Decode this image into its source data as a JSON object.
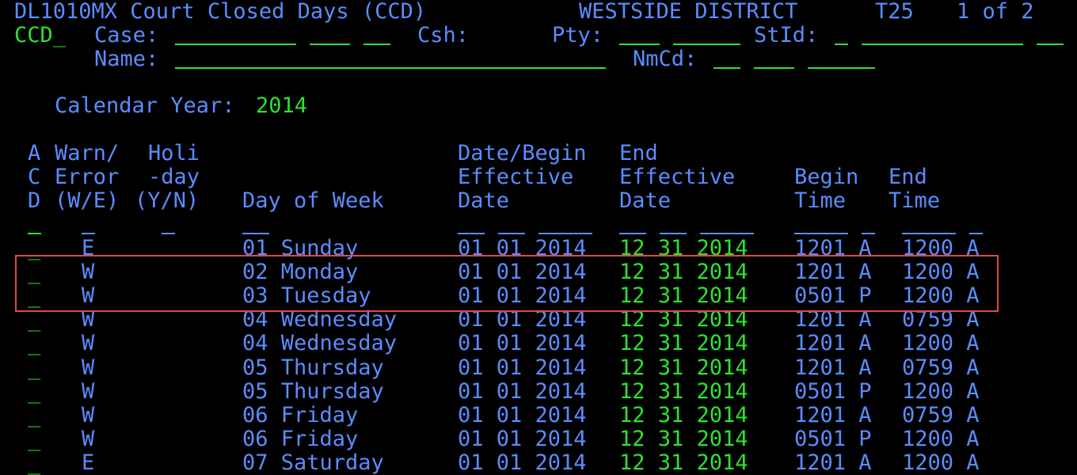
{
  "header": {
    "screen_id": "DL1010MX Court Closed Days (CCD)",
    "district": "WESTSIDE DISTRICT",
    "terminal": "T25",
    "page": "1 of 2"
  },
  "command": {
    "value": "CCD_"
  },
  "fields": {
    "case_label": "Case:",
    "csh_label": "Csh:",
    "pty_label": "Pty:",
    "stid_label": "StId:",
    "name_label": "Name:",
    "nmcd_label": "NmCd:"
  },
  "calendar": {
    "label": "Calendar Year:",
    "year": "2014"
  },
  "columns": {
    "acd": [
      "A",
      "C",
      "D"
    ],
    "warn": [
      "Warn/",
      "Error",
      "(W/E)"
    ],
    "holiday": [
      "Holi",
      "-day",
      "(Y/N)"
    ],
    "day_of_week": "Day of Week",
    "begin_date": [
      "Date/Begin",
      "Effective",
      "Date"
    ],
    "end_date": [
      "End",
      "Effective",
      "Date"
    ],
    "begin_time": [
      "Begin",
      "Time"
    ],
    "end_time": [
      "End",
      "Time"
    ]
  },
  "rows": [
    {
      "acd": "_",
      "we": "E",
      "holiday": "",
      "day": "01 Sunday",
      "begin": "01 01 2014",
      "end": "12 31 2014",
      "btime": "1201 A",
      "etime": "1200 A"
    },
    {
      "acd": "_",
      "we": "W",
      "holiday": "",
      "day": "02 Monday",
      "begin": "01 01 2014",
      "end": "12 31 2014",
      "btime": "1201 A",
      "etime": "1200 A"
    },
    {
      "acd": "_",
      "we": "W",
      "holiday": "",
      "day": "03 Tuesday",
      "begin": "01 01 2014",
      "end": "12 31 2014",
      "btime": "0501 P",
      "etime": "1200 A"
    },
    {
      "acd": "_",
      "we": "W",
      "holiday": "",
      "day": "04 Wednesday",
      "begin": "01 01 2014",
      "end": "12 31 2014",
      "btime": "1201 A",
      "etime": "0759 A"
    },
    {
      "acd": "_",
      "we": "W",
      "holiday": "",
      "day": "04 Wednesday",
      "begin": "01 01 2014",
      "end": "12 31 2014",
      "btime": "1201 A",
      "etime": "1200 A"
    },
    {
      "acd": "_",
      "we": "W",
      "holiday": "",
      "day": "05 Thursday",
      "begin": "01 01 2014",
      "end": "12 31 2014",
      "btime": "1201 A",
      "etime": "0759 A"
    },
    {
      "acd": "_",
      "we": "W",
      "holiday": "",
      "day": "05 Thursday",
      "begin": "01 01 2014",
      "end": "12 31 2014",
      "btime": "0501 P",
      "etime": "1200 A"
    },
    {
      "acd": "_",
      "we": "W",
      "holiday": "",
      "day": "06 Friday",
      "begin": "01 01 2014",
      "end": "12 31 2014",
      "btime": "1201 A",
      "etime": "0759 A"
    },
    {
      "acd": "_",
      "we": "W",
      "holiday": "",
      "day": "06 Friday",
      "begin": "01 01 2014",
      "end": "12 31 2014",
      "btime": "0501 P",
      "etime": "1200 A"
    },
    {
      "acd": "_",
      "we": "E",
      "holiday": "",
      "day": "07 Saturday",
      "begin": "01 01 2014",
      "end": "12 31 2014",
      "btime": "1201 A",
      "etime": "1200 A"
    }
  ]
}
